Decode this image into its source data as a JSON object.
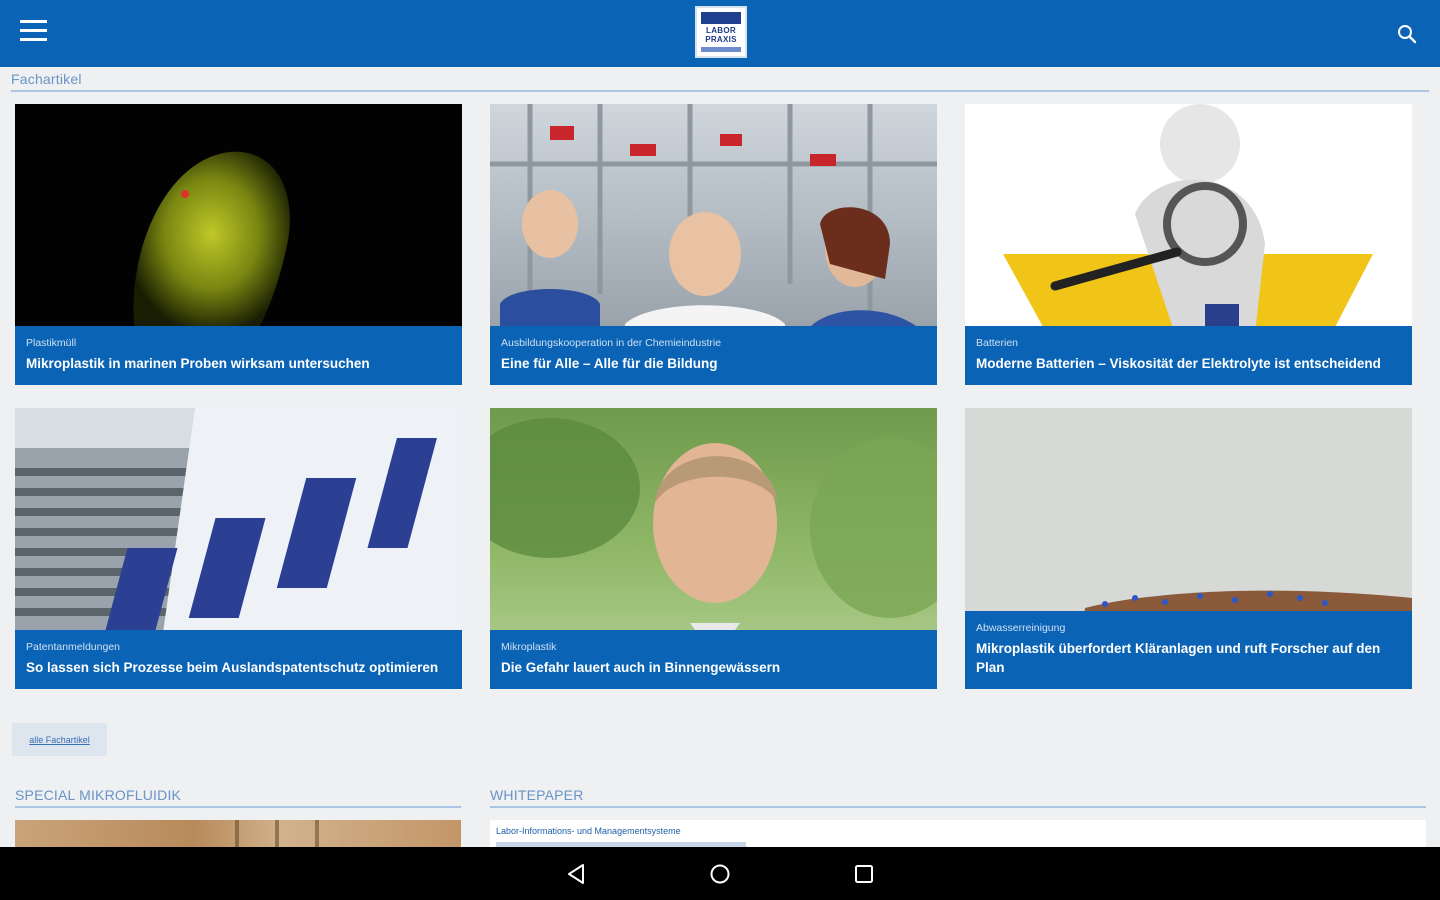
{
  "app": {
    "logo_line1": "LABOR",
    "logo_line2": "PRAXIS",
    "brand_color": "#0a63b4"
  },
  "icons": {
    "menu": "hamburger-menu-icon",
    "search": "search-icon",
    "back": "android-back-icon",
    "home": "android-home-icon",
    "recents": "android-recents-icon"
  },
  "sections": {
    "fachartikel": "Fachartikel",
    "special": "SPECIAL MIKROFLUIDIK",
    "whitepaper": "WHITEPAPER"
  },
  "articles": [
    {
      "category": "Plastikmüll",
      "title": "Mikroplastik in marinen Proben wirksam untersuchen"
    },
    {
      "category": "Ausbildungskooperation in der Chemieindustrie",
      "title": "Eine für Alle – Alle für die Bildung"
    },
    {
      "category": "Batterien",
      "title": "Moderne Batterien – Viskosität der Elektrolyte ist entscheidend"
    },
    {
      "category": "Patentanmeldungen",
      "title": "So lassen sich Prozesse beim Auslandspatentschutz optimieren"
    },
    {
      "category": "Mikroplastik",
      "title": "Die Gefahr lauert auch in Binnengewässern"
    },
    {
      "category": "Abwasserreinigung",
      "title": "Mikroplastik überfordert Kläranlagen und ruft Forscher auf den Plan"
    }
  ],
  "all_button_label": "alle Fachartikel",
  "whitepaper": {
    "category": "Labor-Informations- und Managementsysteme"
  }
}
